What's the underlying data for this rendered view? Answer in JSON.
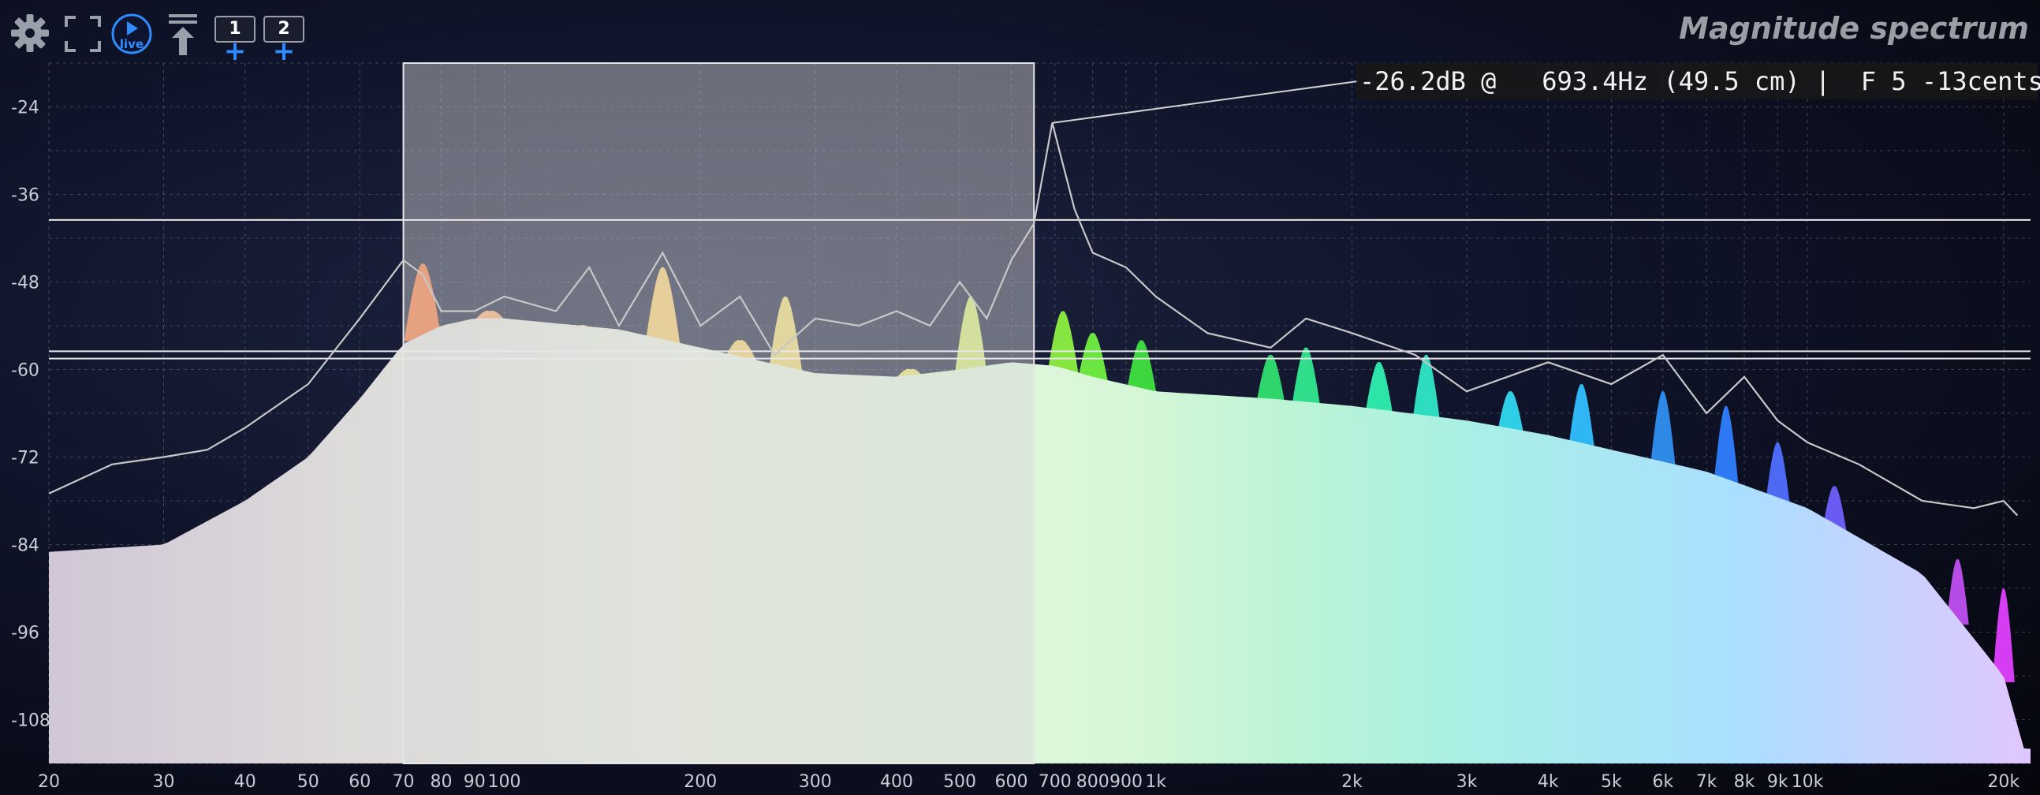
{
  "title": "Magnitude spectrum",
  "toolbar": {
    "settings_icon": "gear-icon",
    "fullscreen_icon": "fullscreen-icon",
    "live_label": "live",
    "freeze_icon": "upload-icon",
    "profile1_label": "1",
    "profile2_label": "2",
    "add_label": "+"
  },
  "readout": "-26.2dB @   693.4Hz (49.5 cm) |  F 5 -13cents",
  "chart_data": {
    "type": "area",
    "xscale": "log",
    "xlim": [
      20,
      22000
    ],
    "ylim": [
      -114,
      -18
    ],
    "x_ticks": [
      {
        "value": 20,
        "label": "20"
      },
      {
        "value": 30,
        "label": "30"
      },
      {
        "value": 40,
        "label": "40"
      },
      {
        "value": 50,
        "label": "50"
      },
      {
        "value": 60,
        "label": "60"
      },
      {
        "value": 70,
        "label": "70"
      },
      {
        "value": 80,
        "label": "80"
      },
      {
        "value": 90,
        "label": "90"
      },
      {
        "value": 100,
        "label": "100"
      },
      {
        "value": 200,
        "label": "200"
      },
      {
        "value": 300,
        "label": "300"
      },
      {
        "value": 400,
        "label": "400"
      },
      {
        "value": 500,
        "label": "500"
      },
      {
        "value": 600,
        "label": "600"
      },
      {
        "value": 700,
        "label": "700"
      },
      {
        "value": 800,
        "label": "800"
      },
      {
        "value": 900,
        "label": "900"
      },
      {
        "value": 1000,
        "label": "1k"
      },
      {
        "value": 2000,
        "label": "2k"
      },
      {
        "value": 3000,
        "label": "3k"
      },
      {
        "value": 4000,
        "label": "4k"
      },
      {
        "value": 5000,
        "label": "5k"
      },
      {
        "value": 6000,
        "label": "6k"
      },
      {
        "value": 7000,
        "label": "7k"
      },
      {
        "value": 8000,
        "label": "8k"
      },
      {
        "value": 9000,
        "label": "9k"
      },
      {
        "value": 10000,
        "label": "10k"
      },
      {
        "value": 20000,
        "label": "20k"
      }
    ],
    "y_ticks": [
      {
        "value": -24,
        "label": "-24"
      },
      {
        "value": -36,
        "label": "-36"
      },
      {
        "value": -48,
        "label": "-48"
      },
      {
        "value": -60,
        "label": "-60"
      },
      {
        "value": -72,
        "label": "-72"
      },
      {
        "value": -84,
        "label": "-84"
      },
      {
        "value": -96,
        "label": "-96"
      },
      {
        "value": -108,
        "label": "-108"
      }
    ],
    "selection": {
      "x_from": 70,
      "x_to": 650
    },
    "cursor": {
      "freq": 693.4,
      "db": -26.2
    },
    "hlines": [
      -39.5,
      -57.5,
      -58.5
    ],
    "smooth_curve": [
      [
        20,
        -85
      ],
      [
        30,
        -84
      ],
      [
        40,
        -78
      ],
      [
        50,
        -72
      ],
      [
        60,
        -64
      ],
      [
        70,
        -56.5
      ],
      [
        80,
        -54
      ],
      [
        90,
        -53
      ],
      [
        100,
        -53
      ],
      [
        150,
        -54.5
      ],
      [
        200,
        -57
      ],
      [
        300,
        -60.5
      ],
      [
        400,
        -61
      ],
      [
        500,
        -60
      ],
      [
        600,
        -59
      ],
      [
        700,
        -59.5
      ],
      [
        800,
        -61
      ],
      [
        1000,
        -63
      ],
      [
        1500,
        -64
      ],
      [
        2000,
        -65
      ],
      [
        3000,
        -67
      ],
      [
        4000,
        -69
      ],
      [
        5000,
        -71
      ],
      [
        7000,
        -74
      ],
      [
        10000,
        -79
      ],
      [
        15000,
        -88
      ],
      [
        20000,
        -102
      ],
      [
        21500,
        -112
      ]
    ],
    "peak_hold_curve": [
      [
        20,
        -77
      ],
      [
        25,
        -73
      ],
      [
        30,
        -72
      ],
      [
        35,
        -71
      ],
      [
        40,
        -68
      ],
      [
        50,
        -62
      ],
      [
        60,
        -53
      ],
      [
        70,
        -45
      ],
      [
        75,
        -47
      ],
      [
        80,
        -52
      ],
      [
        90,
        -52
      ],
      [
        100,
        -50
      ],
      [
        120,
        -52
      ],
      [
        135,
        -46
      ],
      [
        150,
        -54
      ],
      [
        175,
        -44
      ],
      [
        200,
        -54
      ],
      [
        230,
        -50
      ],
      [
        260,
        -58
      ],
      [
        300,
        -53
      ],
      [
        350,
        -54
      ],
      [
        400,
        -52
      ],
      [
        450,
        -54
      ],
      [
        500,
        -48
      ],
      [
        550,
        -53
      ],
      [
        600,
        -45
      ],
      [
        650,
        -40
      ],
      [
        693.4,
        -26.2
      ],
      [
        750,
        -38
      ],
      [
        800,
        -44
      ],
      [
        900,
        -46
      ],
      [
        1000,
        -50
      ],
      [
        1200,
        -55
      ],
      [
        1500,
        -57
      ],
      [
        1700,
        -53
      ],
      [
        2000,
        -55
      ],
      [
        2500,
        -58
      ],
      [
        3000,
        -63
      ],
      [
        4000,
        -59
      ],
      [
        5000,
        -62
      ],
      [
        6000,
        -58
      ],
      [
        7000,
        -66
      ],
      [
        8000,
        -61
      ],
      [
        9000,
        -67
      ],
      [
        10000,
        -70
      ],
      [
        12000,
        -73
      ],
      [
        15000,
        -78
      ],
      [
        18000,
        -79
      ],
      [
        20000,
        -78
      ],
      [
        21000,
        -80
      ]
    ],
    "peaks": [
      {
        "freq": 75,
        "db": -45.5,
        "color": "#ff7b3a"
      },
      {
        "freq": 95,
        "db": -52,
        "color": "#ffb070"
      },
      {
        "freq": 130,
        "db": -54,
        "color": "#ffd080"
      },
      {
        "freq": 175,
        "db": -46,
        "color": "#ffd26a"
      },
      {
        "freq": 230,
        "db": -56,
        "color": "#ffd870"
      },
      {
        "freq": 270,
        "db": -50,
        "color": "#f5df70"
      },
      {
        "freq": 420,
        "db": -60,
        "color": "#f0ec70"
      },
      {
        "freq": 520,
        "db": -50,
        "color": "#d8f070"
      },
      {
        "freq": 720,
        "db": -52,
        "color": "#8cf040"
      },
      {
        "freq": 800,
        "db": -55,
        "color": "#70f040"
      },
      {
        "freq": 950,
        "db": -56,
        "color": "#40e040"
      },
      {
        "freq": 1500,
        "db": -58,
        "color": "#30e070"
      },
      {
        "freq": 1700,
        "db": -57,
        "color": "#30e890"
      },
      {
        "freq": 2200,
        "db": -59,
        "color": "#30f0b0"
      },
      {
        "freq": 2600,
        "db": -58,
        "color": "#30e8c8"
      },
      {
        "freq": 3500,
        "db": -63,
        "color": "#30d8f0"
      },
      {
        "freq": 4500,
        "db": -62,
        "color": "#30c0ff"
      },
      {
        "freq": 6000,
        "db": -63,
        "color": "#3090f0"
      },
      {
        "freq": 7500,
        "db": -65,
        "color": "#3080ff"
      },
      {
        "freq": 9000,
        "db": -70,
        "color": "#5070ff"
      },
      {
        "freq": 11000,
        "db": -76,
        "color": "#7060ff"
      },
      {
        "freq": 17000,
        "db": -86,
        "color": "#c050f0"
      },
      {
        "freq": 20000,
        "db": -90,
        "color": "#e040ff"
      }
    ]
  }
}
